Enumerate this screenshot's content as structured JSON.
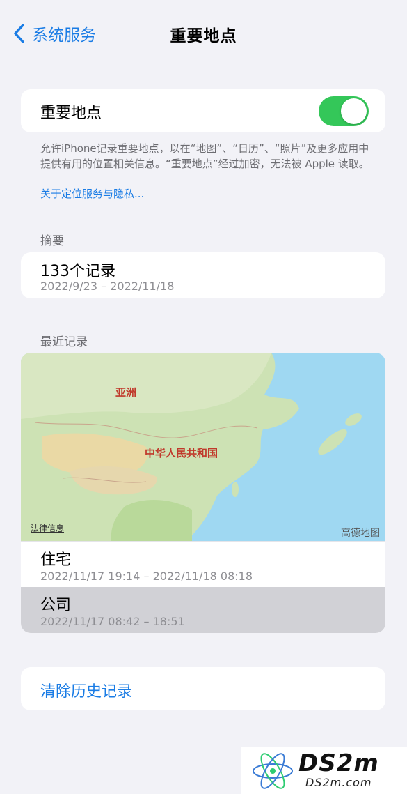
{
  "nav": {
    "back_label": "系统服务",
    "title": "重要地点"
  },
  "toggle": {
    "label": "重要地点",
    "on": true
  },
  "footer": {
    "note": "允许iPhone记录重要地点，以在“地图”、“日历”、“照片”及更多应用中提供有用的位置相关信息。“重要地点”经过加密，无法被 Apple 读取。",
    "link": "关于定位服务与隐私..."
  },
  "summary": {
    "header": "摘要",
    "count": "133个记录",
    "range": "2022/9/23 – 2022/11/18"
  },
  "recent": {
    "header": "最近记录",
    "map": {
      "label_continent": "亚洲",
      "label_country": "中华人民共和国",
      "legal": "法律信息",
      "brand": "高德地图"
    },
    "items": [
      {
        "title": "住宅",
        "range": "2022/11/17 19:14 – 2022/11/18 08:18"
      },
      {
        "title": "公司",
        "range": "2022/11/17 08:42 – 18:51"
      }
    ]
  },
  "clear": {
    "label": "清除历史记录"
  },
  "watermark": {
    "big": "DS2m",
    "small": "DS2m.com"
  },
  "colors": {
    "accent": "#1a7ce5",
    "switch_on": "#34c759",
    "background": "#f2f2f7"
  }
}
